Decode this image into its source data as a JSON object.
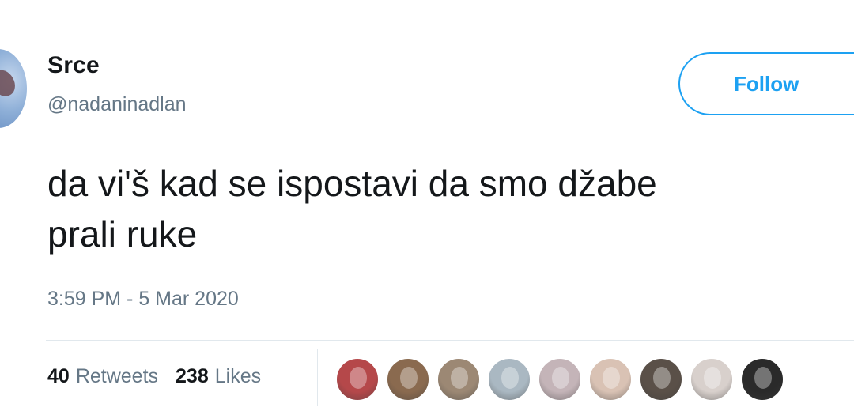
{
  "tweet": {
    "display_name": "Srce",
    "handle": "@nadaninadlan",
    "follow_label": "Follow",
    "text": "da vi'š kad se ispostavi da smo džabe\nprali ruke",
    "timestamp": "3:59 PM - 5 Mar 2020",
    "stats": {
      "retweets_count": "40",
      "retweets_label": "Retweets",
      "likes_count": "238",
      "likes_label": "Likes"
    },
    "likers": [
      {
        "icon": "liker-avatar-1",
        "color": "#b5484a"
      },
      {
        "icon": "liker-avatar-2",
        "color": "#8a6a4f"
      },
      {
        "icon": "liker-avatar-3",
        "color": "#9c8874"
      },
      {
        "icon": "default-avatar-icon",
        "color": "#aab8c2"
      },
      {
        "icon": "liker-avatar-5",
        "color": "#c4b4b8"
      },
      {
        "icon": "liker-avatar-6",
        "color": "#d9c2b4"
      },
      {
        "icon": "liker-avatar-7",
        "color": "#5a5048"
      },
      {
        "icon": "liker-avatar-8",
        "color": "#d8d0cc"
      },
      {
        "icon": "liker-avatar-9",
        "color": "#2a2a2a"
      }
    ]
  },
  "colors": {
    "accent": "#1da1f2",
    "text_primary": "#14171a",
    "text_secondary": "#657786",
    "divider": "#e1e8ed"
  }
}
